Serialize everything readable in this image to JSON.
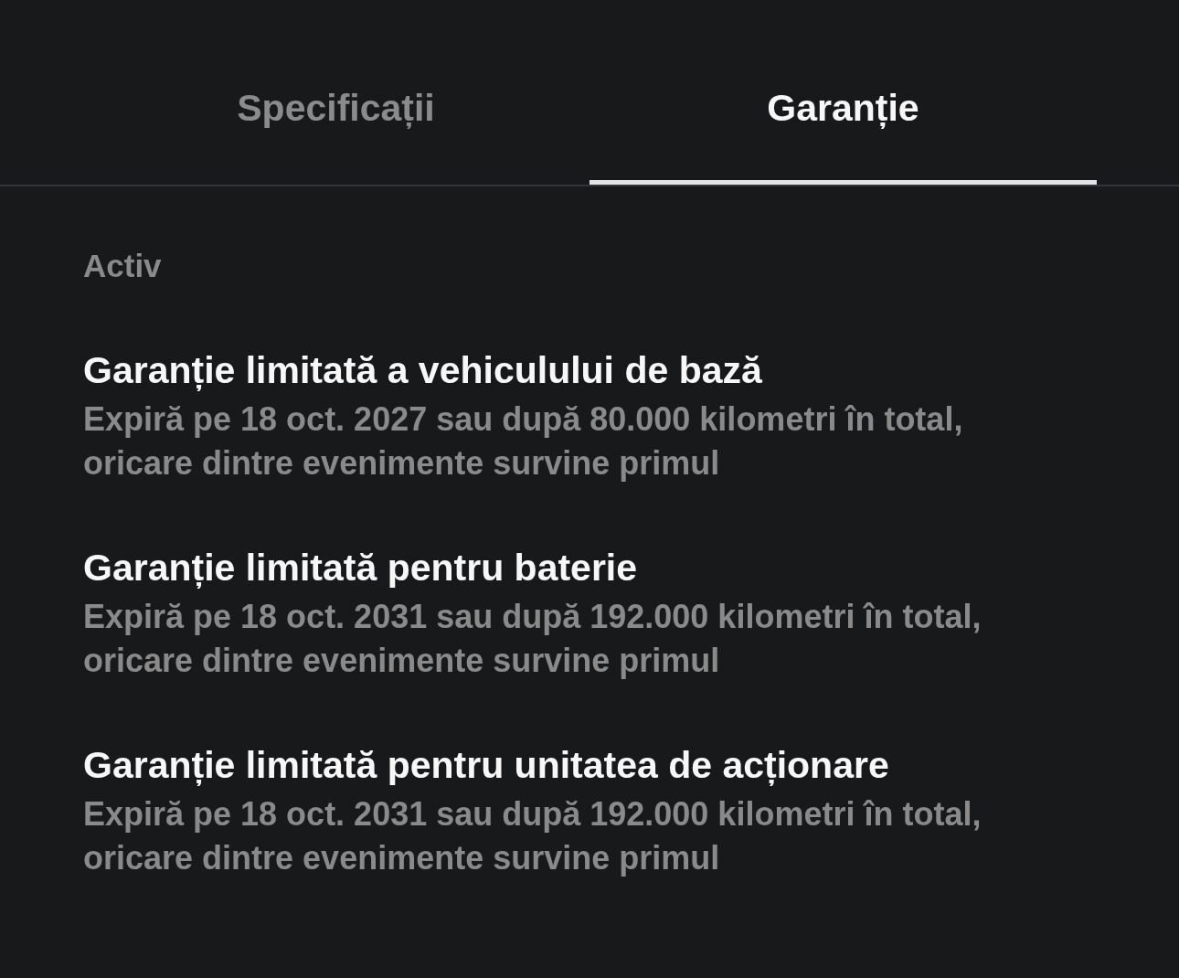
{
  "tabs": [
    {
      "label": "Specificații",
      "selected": false
    },
    {
      "label": "Garanție",
      "selected": true
    }
  ],
  "section": {
    "heading": "Activ"
  },
  "warranties": [
    {
      "title": "Garanție limitată a vehiculului de bază",
      "description": "Expiră pe 18 oct. 2027 sau după 80.000 kilometri în total, oricare dintre evenimente survine primul"
    },
    {
      "title": "Garanție limitată pentru baterie",
      "description": "Expiră pe 18 oct. 2031 sau după 192.000 kilometri în total, oricare dintre evenimente survine primul"
    },
    {
      "title": "Garanție limitată pentru unitatea de acționare",
      "description": "Expiră pe 18 oct. 2031 sau după 192.000 kilometri în total, oricare dintre evenimente survine primul"
    }
  ]
}
